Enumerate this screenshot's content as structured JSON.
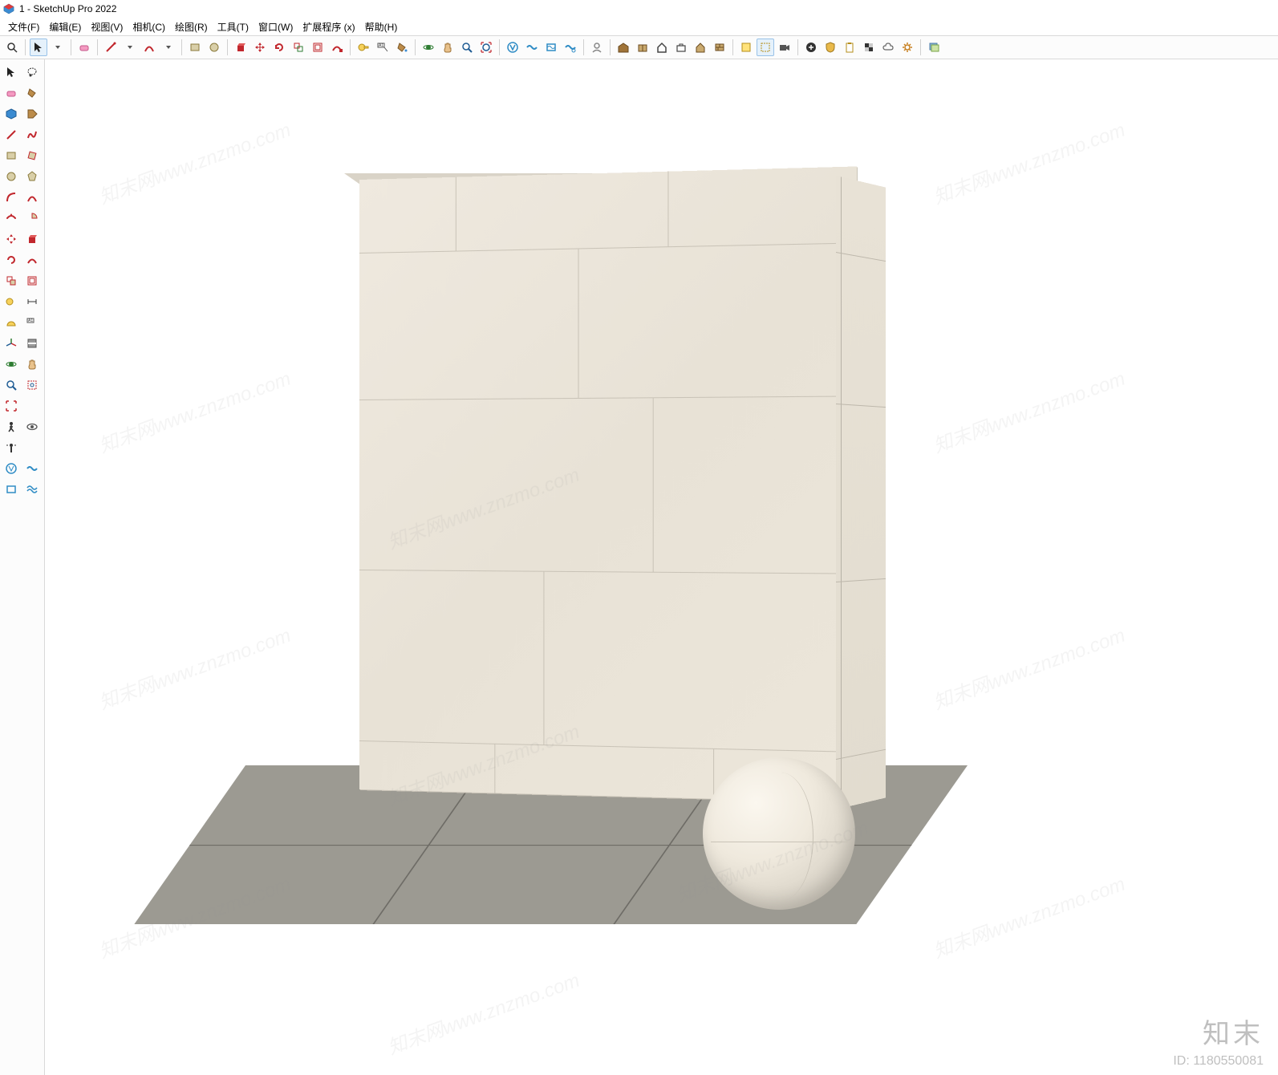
{
  "window": {
    "title": "1 - SketchUp Pro 2022"
  },
  "menu": {
    "items": [
      {
        "label": "文件(F)"
      },
      {
        "label": "编辑(E)"
      },
      {
        "label": "视图(V)"
      },
      {
        "label": "相机(C)"
      },
      {
        "label": "绘图(R)"
      },
      {
        "label": "工具(T)"
      },
      {
        "label": "窗口(W)"
      },
      {
        "label": "扩展程序 (x)"
      },
      {
        "label": "帮助(H)"
      }
    ]
  },
  "htoolbar": {
    "groups": [
      [
        "search-icon"
      ],
      [
        "select-cursor-icon",
        "dropdown-icon"
      ],
      [
        "eraser-icon"
      ],
      [
        "line-icon",
        "dropdown-icon",
        "arc-icon",
        "dropdown-icon"
      ],
      [
        "rectangle-icon",
        "circle-icon"
      ],
      [
        "pushpull-icon",
        "move-icon",
        "rotate-icon",
        "scale-icon",
        "offset-icon",
        "followme-icon"
      ],
      [
        "tape-icon",
        "text-label-icon",
        "paint-bucket-icon"
      ],
      [
        "orbit-icon",
        "pan-icon",
        "zoom-icon",
        "zoom-extents-icon"
      ],
      [
        "vray-icon",
        "vray-render-icon",
        "vray-frame-icon",
        "vray-settings-icon"
      ],
      [
        "user-icon"
      ],
      [
        "warehouse-icon",
        "box-icon",
        "home-icon",
        "briefcase-icon",
        "house-icon",
        "wall-icon"
      ],
      [
        "component-icon",
        "bbox-icon",
        "camera-icon"
      ],
      [
        "add-circle-icon",
        "shield-icon",
        "clipboard-icon",
        "checker-icon",
        "cloud-icon",
        "gear-icon"
      ],
      [
        "image-stack-icon"
      ]
    ]
  },
  "ltoolbar": {
    "rows": [
      [
        "select-cursor-icon",
        "lasso-icon"
      ],
      [
        "eraser-icon",
        "paint-bucket-icon"
      ],
      [
        "cube-blue-icon",
        "tag-brown-icon"
      ],
      [
        "line-icon",
        "freehand-red-icon"
      ],
      [
        "rectangle-icon",
        "rect-rot-icon"
      ],
      [
        "circle-icon",
        "polygon-icon"
      ],
      [
        "arc-red-icon",
        "arc2pt-icon"
      ],
      [
        "arc3pt-icon",
        "pie-icon"
      ],
      [
        "move-red-icon",
        "pushpull-icon"
      ],
      [
        "rotate-red-icon",
        "followme-red-icon"
      ],
      [
        "scale-red-icon",
        "offset-red-icon"
      ],
      [
        "tape-yellow-icon",
        "dim-icon"
      ],
      [
        "protractor-icon",
        "text-label-icon"
      ],
      [
        "axes-icon",
        "section-icon"
      ],
      [
        "orbit-green-icon",
        "pan-green-icon"
      ],
      [
        "zoom-icon",
        "zoom-window-icon"
      ],
      [
        "zoom-extents-red-icon",
        ""
      ],
      [
        "walk-icon",
        "look-icon"
      ],
      [
        "position-icon",
        ""
      ],
      [
        "vray-asset-icon",
        "vray-light-icon"
      ],
      [
        "vray-blue-icon",
        "vray-wave-icon"
      ]
    ]
  },
  "watermark": {
    "brand": "知末",
    "id_label": "ID: 1180550081",
    "repeat_text": "知末网www.znzmo.com"
  }
}
